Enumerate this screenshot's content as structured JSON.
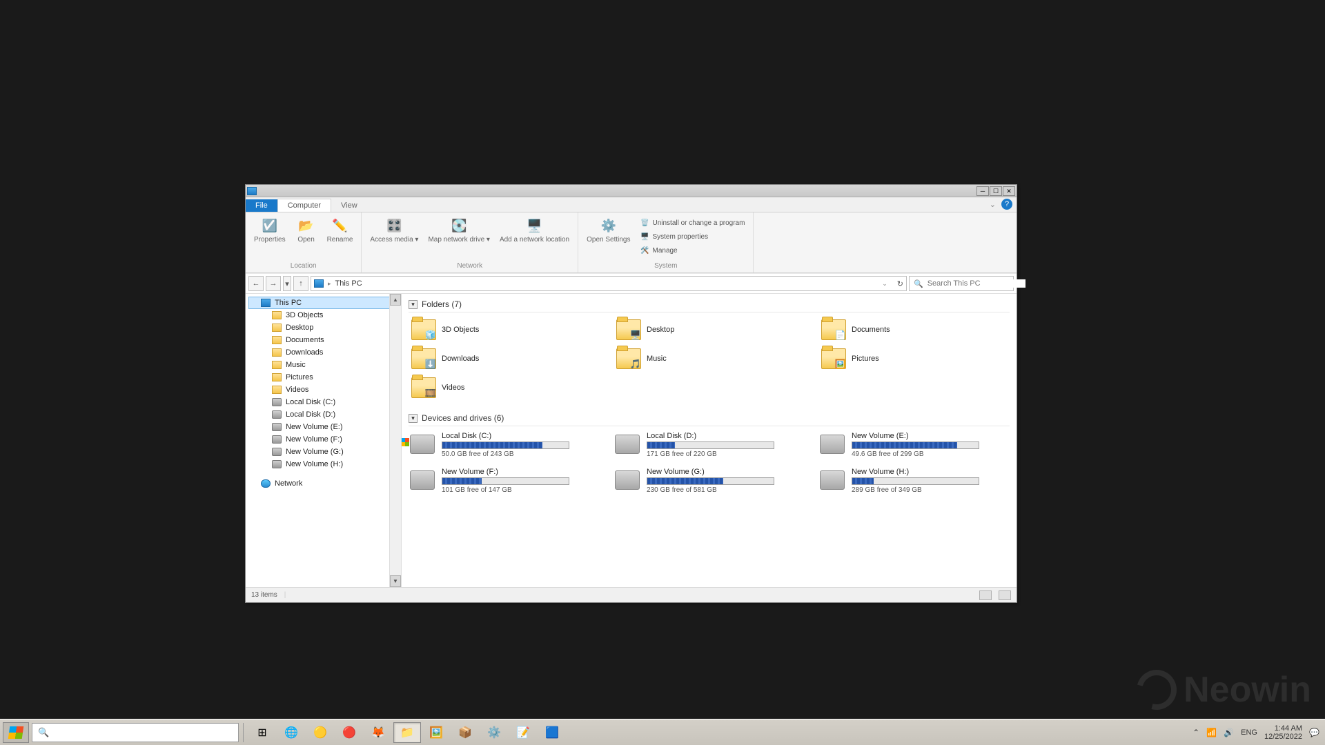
{
  "window": {
    "tabs": {
      "file": "File",
      "computer": "Computer",
      "view": "View"
    },
    "ribbon": {
      "location": {
        "label": "Location",
        "properties": "Properties",
        "open": "Open",
        "rename": "Rename"
      },
      "network": {
        "label": "Network",
        "access_media": "Access media ▾",
        "map_drive": "Map network drive ▾",
        "add_location": "Add a network location"
      },
      "system": {
        "label": "System",
        "open_settings": "Open Settings",
        "uninstall": "Uninstall or change a program",
        "properties": "System properties",
        "manage": "Manage"
      }
    },
    "address": {
      "crumb": "This PC",
      "refresh": "↻"
    },
    "search": {
      "placeholder": "Search This PC"
    },
    "sidebar": {
      "this_pc": "This PC",
      "items": [
        {
          "label": "3D Objects",
          "icon": "fold"
        },
        {
          "label": "Desktop",
          "icon": "fold"
        },
        {
          "label": "Documents",
          "icon": "fold"
        },
        {
          "label": "Downloads",
          "icon": "fold"
        },
        {
          "label": "Music",
          "icon": "fold"
        },
        {
          "label": "Pictures",
          "icon": "fold"
        },
        {
          "label": "Videos",
          "icon": "fold"
        },
        {
          "label": "Local Disk (C:)",
          "icon": "disk"
        },
        {
          "label": "Local Disk (D:)",
          "icon": "disk"
        },
        {
          "label": "New Volume (E:)",
          "icon": "disk"
        },
        {
          "label": "New Volume (F:)",
          "icon": "disk"
        },
        {
          "label": "New Volume (G:)",
          "icon": "disk"
        },
        {
          "label": "New Volume (H:)",
          "icon": "disk"
        }
      ],
      "network": "Network"
    },
    "folders_hdr": "Folders (7)",
    "folders": [
      {
        "label": "3D Objects",
        "overlay": "🧊"
      },
      {
        "label": "Desktop",
        "overlay": "🖥️"
      },
      {
        "label": "Documents",
        "overlay": "📄"
      },
      {
        "label": "Downloads",
        "overlay": "⬇️"
      },
      {
        "label": "Music",
        "overlay": "🎵"
      },
      {
        "label": "Pictures",
        "overlay": "🖼️"
      },
      {
        "label": "Videos",
        "overlay": "🎞️"
      }
    ],
    "drives_hdr": "Devices and drives (6)",
    "drives": [
      {
        "label": "Local Disk (C:)",
        "free": "50.0 GB free of 243 GB",
        "pct": 79,
        "win": true
      },
      {
        "label": "Local Disk (D:)",
        "free": "171 GB free of 220 GB",
        "pct": 22
      },
      {
        "label": "New Volume (E:)",
        "free": "49.6 GB free of 299 GB",
        "pct": 83
      },
      {
        "label": "New Volume (F:)",
        "free": "101 GB free of 147 GB",
        "pct": 31
      },
      {
        "label": "New Volume (G:)",
        "free": "230 GB free of 581 GB",
        "pct": 60
      },
      {
        "label": "New Volume (H:)",
        "free": "289 GB free of 349 GB",
        "pct": 17
      }
    ],
    "status": {
      "items": "13 items"
    }
  },
  "taskbar": {
    "lang": "ENG",
    "time": "1:44 AM",
    "date": "12/25/2022"
  },
  "watermark": "Neowin"
}
